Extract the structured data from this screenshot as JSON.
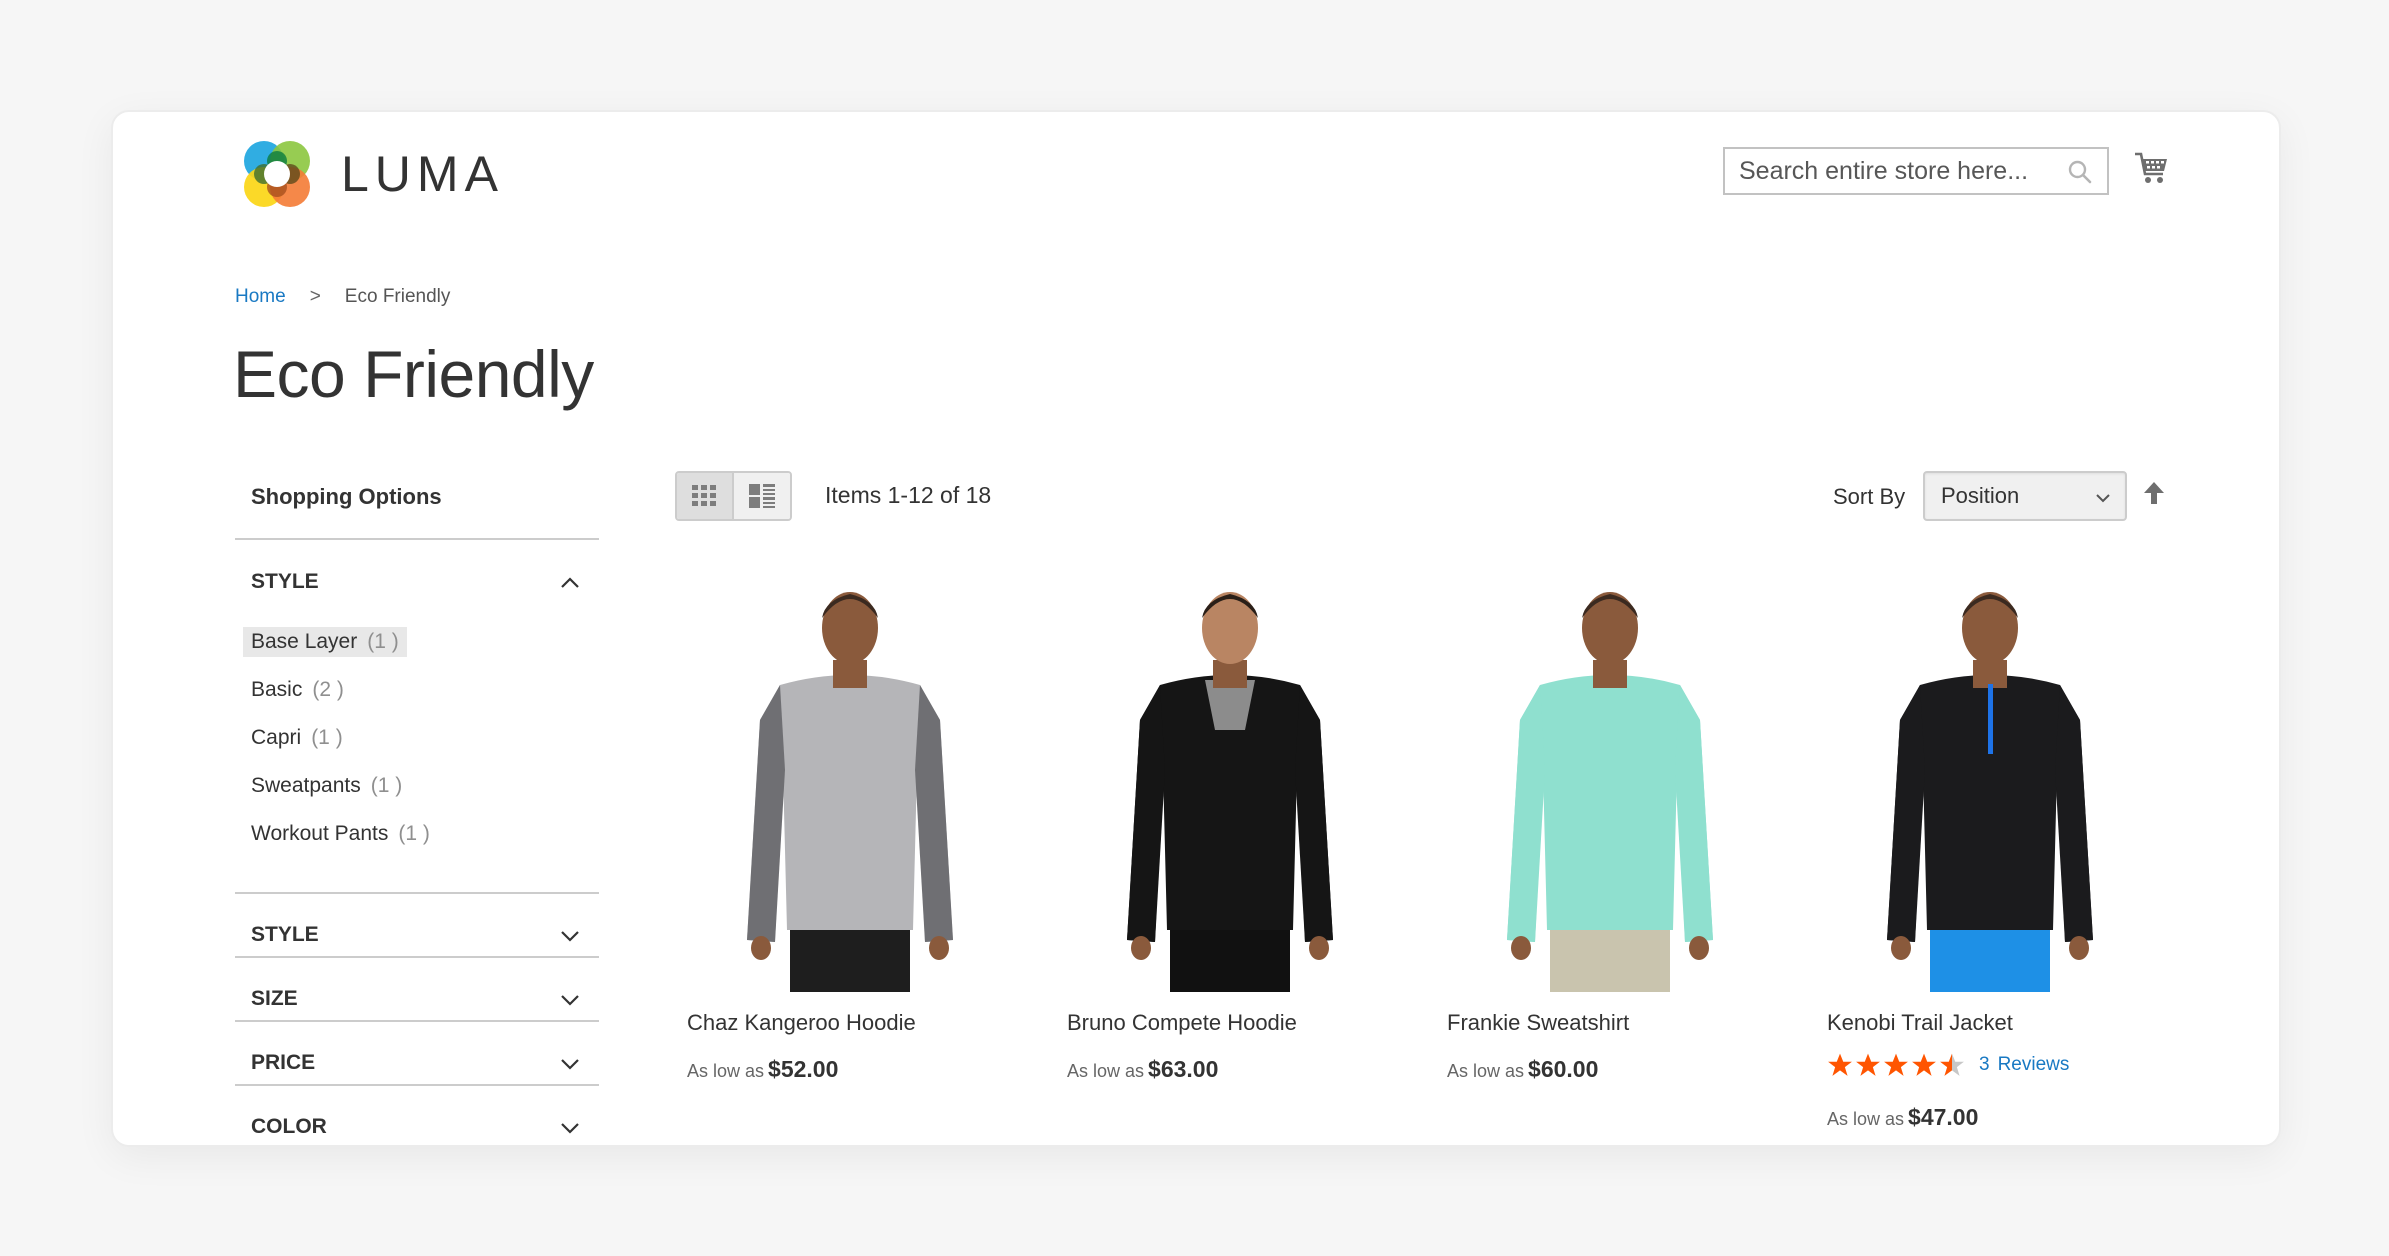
{
  "header": {
    "brand": "LUMA",
    "search_placeholder": "Search entire store here...",
    "search_icon": "search-icon",
    "cart_icon": "cart-icon"
  },
  "breadcrumb": {
    "home": "Home",
    "separator": ">",
    "current": "Eco Friendly"
  },
  "page_title": "Eco Friendly",
  "sidebar": {
    "title": "Shopping Options",
    "expanded_filter": {
      "label": "STYLE",
      "options": [
        {
          "label": "Base Layer",
          "count": "(1 )",
          "active": true
        },
        {
          "label": "Basic",
          "count": "(2 )",
          "active": false
        },
        {
          "label": "Capri",
          "count": "(1 )",
          "active": false
        },
        {
          "label": "Sweatpants",
          "count": "(1 )",
          "active": false
        },
        {
          "label": "Workout Pants",
          "count": "(1 )",
          "active": false
        }
      ]
    },
    "collapsed_filters": [
      {
        "label": "STYLE"
      },
      {
        "label": "SIZE"
      },
      {
        "label": "PRICE"
      },
      {
        "label": "COLOR"
      }
    ]
  },
  "toolbar": {
    "view_modes": [
      {
        "name": "grid",
        "active": true
      },
      {
        "name": "list",
        "active": false
      }
    ],
    "items_count": "Items 1-12 of 18",
    "sort_label": "Sort By",
    "sort_value": "Position",
    "sort_direction_icon": "arrow-up-icon"
  },
  "products": [
    {
      "name": "Chaz Kangeroo Hoodie",
      "price_label": "As low as",
      "price": "$52.00",
      "shirt_color": "#b5b5b8",
      "sleeve_color": "#6f6f73",
      "pants_color": "#1e1e1e"
    },
    {
      "name": "Bruno Compete Hoodie",
      "price_label": "As low as",
      "price": "$63.00",
      "shirt_color": "#151515",
      "sleeve_color": "#151515",
      "pants_color": "#111111"
    },
    {
      "name": "Frankie Sweatshirt",
      "price_label": "As low as",
      "price": "$60.00",
      "shirt_color": "#8fe0cf",
      "sleeve_color": "#8fe0cf",
      "pants_color": "#c9c4ae"
    },
    {
      "name": "Kenobi Trail Jacket",
      "price_label": "As low as",
      "price": "$47.00",
      "shirt_color": "#1b1b1d",
      "sleeve_color": "#1b1b1d",
      "pants_color": "#1e90e6",
      "rating": {
        "stars": 4.5,
        "max": 5,
        "reviews_count": "3",
        "reviews_label": "Reviews"
      }
    }
  ],
  "colors": {
    "link": "#1979c3",
    "star": "#ff5501",
    "star_empty": "#c7c7c7",
    "text": "#333333"
  }
}
